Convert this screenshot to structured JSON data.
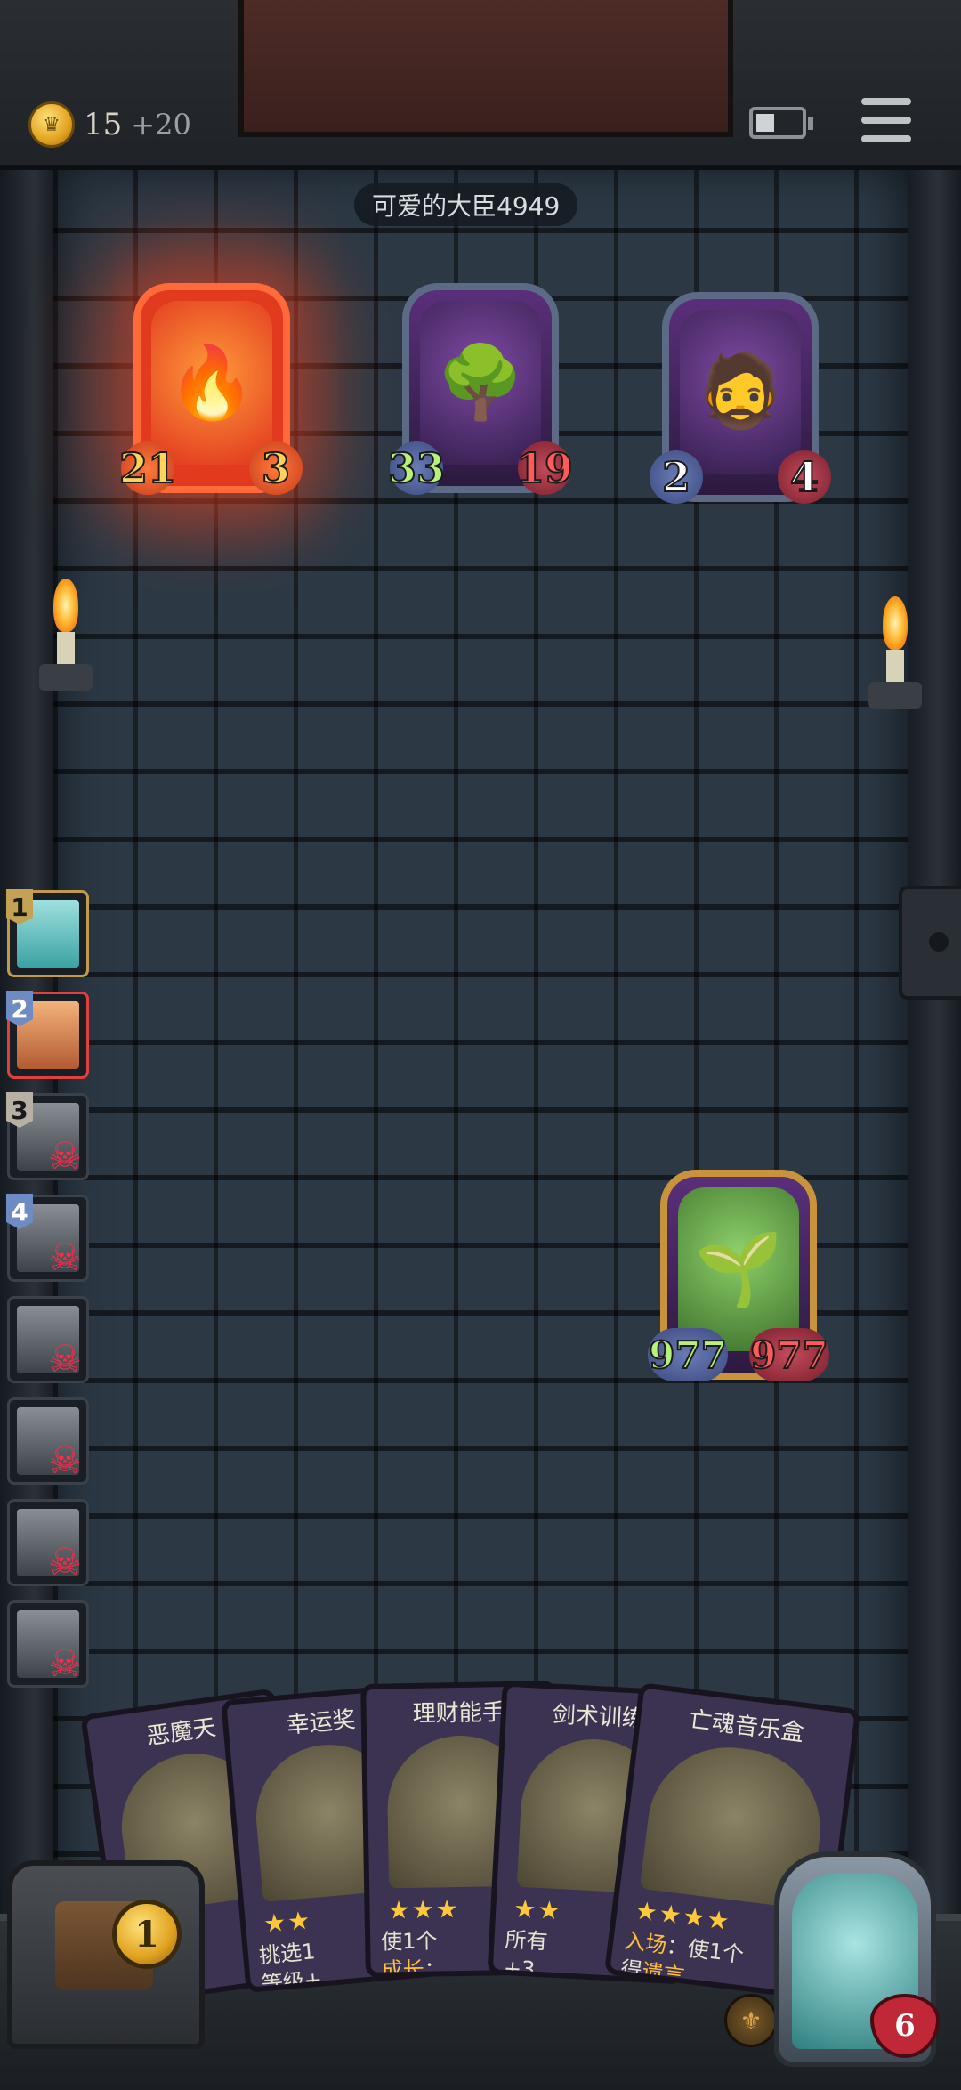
{
  "header": {
    "gold": "15",
    "gold_bonus": "+20",
    "opponent_name": "可爱的大臣4949"
  },
  "enemy_units": [
    {
      "attack": "21",
      "health": "3"
    },
    {
      "attack": "33",
      "health": "19"
    },
    {
      "attack": "2",
      "health": "4"
    }
  ],
  "player_unit": {
    "attack": "977",
    "health": "977"
  },
  "team": [
    {
      "slot": "1"
    },
    {
      "slot": "2"
    },
    {
      "slot": "3"
    },
    {
      "slot": "4"
    }
  ],
  "hand": [
    {
      "title": "恶魔天",
      "stars": "★★",
      "text": ""
    },
    {
      "title": "幸运奖",
      "stars": "★★",
      "text_a": "挑选1",
      "text_b": "等级+"
    },
    {
      "title": "理财能手",
      "stars": "★★★",
      "text_a": "使1个",
      "text_b_hl": "成长",
      "text_b": "："
    },
    {
      "title": "剑术训练",
      "stars": "★★",
      "text_a": "所有",
      "text_b": "+3"
    },
    {
      "title": "亡魂音乐盒",
      "stars": "★★★★",
      "text_a_hl": "入场",
      "text_a": "：使1个",
      "text_b": "得",
      "text_b_hl": "遗言"
    }
  ],
  "chest_count": "1",
  "hero_health": "6",
  "colors": {
    "accent_gold": "#e3a321",
    "enemy_fire": "#e23a1f",
    "health_red": "#c02838"
  }
}
